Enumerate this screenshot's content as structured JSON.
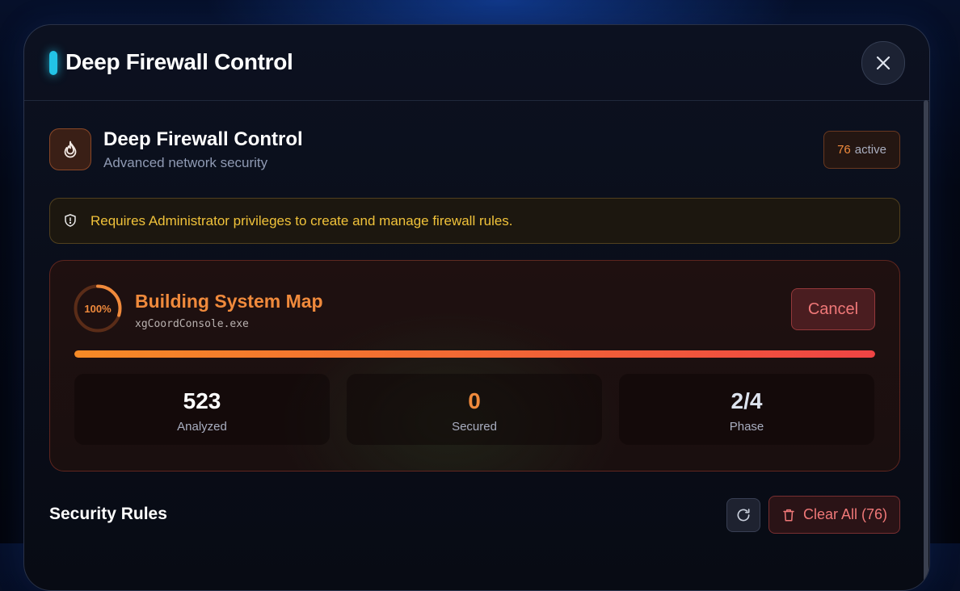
{
  "dialog": {
    "title": "Deep Firewall Control"
  },
  "tool": {
    "title": "Deep Firewall Control",
    "subtitle": "Advanced network security",
    "icon": "flame-icon",
    "active_count": "76",
    "active_label": "active"
  },
  "warning": {
    "icon": "shield-icon",
    "text": "Requires Administrator privileges to create and manage firewall rules."
  },
  "progress": {
    "percent_label": "100%",
    "percent": 100,
    "title": "Building System Map",
    "process": "xgCoordConsole.exe",
    "cancel_label": "Cancel",
    "stats": [
      {
        "value": "523",
        "label": "Analyzed",
        "color": "#ffffff"
      },
      {
        "value": "0",
        "label": "Secured",
        "color": "#f08a3c"
      },
      {
        "value": "2/4",
        "label": "Phase",
        "color": "#dde3ee"
      }
    ]
  },
  "rules": {
    "title": "Security Rules",
    "refresh_icon": "refresh-icon",
    "clear_label": "Clear All (76)",
    "clear_icon": "trash-icon"
  },
  "colors": {
    "accent": "#22c3e6",
    "orange": "#f08a3c",
    "danger": "#f07878",
    "warning": "#f0c23a"
  }
}
